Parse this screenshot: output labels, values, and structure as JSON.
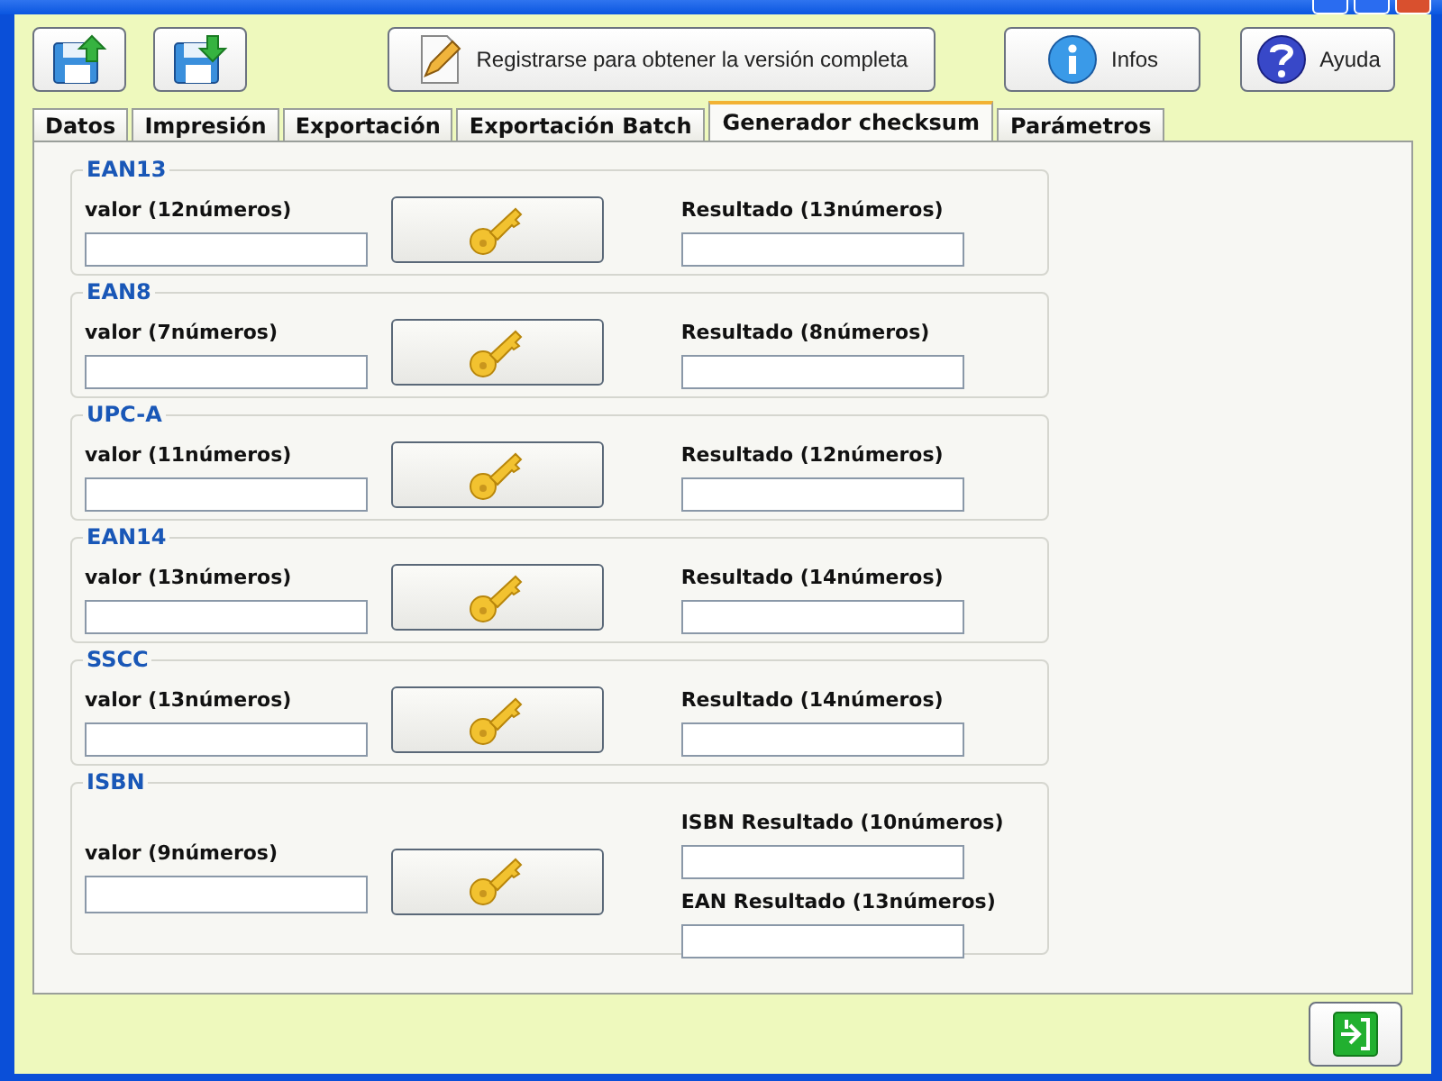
{
  "toolbar": {
    "register_button": "Registrarse para obtener la versión completa",
    "infos_button": "Infos",
    "help_button": "Ayuda"
  },
  "tabs": [
    {
      "label": "Datos",
      "selected": false
    },
    {
      "label": "Impresión",
      "selected": false
    },
    {
      "label": "Exportación",
      "selected": false
    },
    {
      "label": "Exportación Batch",
      "selected": false
    },
    {
      "label": "Generador checksum",
      "selected": true
    },
    {
      "label": "Parámetros",
      "selected": false
    }
  ],
  "groups": [
    {
      "kind": "single",
      "title": "EAN13",
      "input_label": "valor (12números)",
      "results": [
        "Resultado (13números)"
      ]
    },
    {
      "kind": "single",
      "title": "EAN8",
      "input_label": "valor (7números)",
      "results": [
        "Resultado (8números)"
      ]
    },
    {
      "kind": "single",
      "title": "UPC-A",
      "input_label": "valor (11números)",
      "results": [
        "Resultado (12números)"
      ]
    },
    {
      "kind": "single",
      "title": "EAN14",
      "input_label": "valor (13números)",
      "results": [
        "Resultado (14números)"
      ]
    },
    {
      "kind": "single",
      "title": "SSCC",
      "input_label": "valor (13números)",
      "results": [
        "Resultado (14números)"
      ]
    },
    {
      "kind": "double",
      "title": "ISBN",
      "input_label": "valor (9números)",
      "results": [
        "ISBN Resultado (10números)",
        "EAN Resultado (13números)"
      ]
    }
  ]
}
